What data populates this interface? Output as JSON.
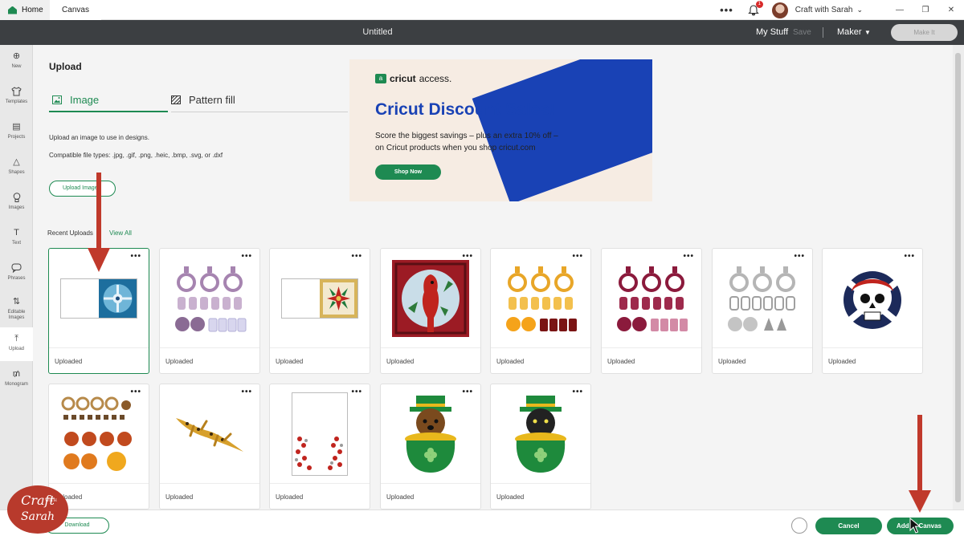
{
  "topbar": {
    "home_label": "Home",
    "canvas_tab": "Canvas",
    "more_dots": "•••",
    "notification_count": "1",
    "user_name": "Craft with Sarah",
    "minimize": "—",
    "restore": "❐",
    "close": "✕"
  },
  "header": {
    "title": "Untitled",
    "my_stuff": "My Stuff",
    "save": "Save",
    "machine": "Maker",
    "make_it": "Make It"
  },
  "rail": [
    {
      "label": "New",
      "icon": "plus-icon",
      "glyph": "⊕"
    },
    {
      "label": "Templates",
      "icon": "shirt-icon",
      "glyph": "👕"
    },
    {
      "label": "Projects",
      "icon": "projects-icon",
      "glyph": "▤"
    },
    {
      "label": "Shapes",
      "icon": "shapes-icon",
      "glyph": "△"
    },
    {
      "label": "Images",
      "icon": "lightbulb-icon",
      "glyph": "♀"
    },
    {
      "label": "Text",
      "icon": "text-icon",
      "glyph": "T"
    },
    {
      "label": "Phrases",
      "icon": "speech-bubble-icon",
      "glyph": "💬"
    },
    {
      "label": "Editable Images",
      "icon": "editable-images-icon",
      "glyph": "⇅"
    },
    {
      "label": "Upload",
      "icon": "upload-icon",
      "glyph": "⤒"
    },
    {
      "label": "Monogram",
      "icon": "monogram-icon",
      "glyph": "₥"
    }
  ],
  "upload": {
    "title": "Upload",
    "tab_image": "Image",
    "tab_pattern": "Pattern fill",
    "description": "Upload an image to use in designs.",
    "types": "Compatible file types: .jpg, .gif, .png, .heic, .bmp, .svg, or .dxf",
    "upload_button": "Upload Image",
    "recent_label": "Recent Uploads",
    "view_all": "View All"
  },
  "ad": {
    "brand": "cricut",
    "brand_suffix": "access.",
    "headline": "Cricut Discount Sales!",
    "line1": "Score the biggest savings – plus an extra 10% off –",
    "line2": "on Cricut products when you shop cricut.com",
    "cta": "Shop Now",
    "accent": "#1942b5"
  },
  "cards": [
    {
      "caption": "Uploaded",
      "thumb": "blue-snowflake-tile"
    },
    {
      "caption": "Uploaded",
      "thumb": "purple-ornaments"
    },
    {
      "caption": "Uploaded",
      "thumb": "poinsettia-tile"
    },
    {
      "caption": "Uploaded",
      "thumb": "cardinal-stained-glass"
    },
    {
      "caption": "Uploaded",
      "thumb": "orange-ornaments"
    },
    {
      "caption": "Uploaded",
      "thumb": "maroon-ornaments"
    },
    {
      "caption": "Uploaded",
      "thumb": "grey-ornaments"
    },
    {
      "caption": "Uploaded",
      "thumb": "pirate-skull"
    },
    {
      "caption": "Uploaded",
      "thumb": "autumn-pieces"
    },
    {
      "caption": "Uploaded",
      "thumb": "gecko"
    },
    {
      "caption": "Uploaded",
      "thumb": "red-flower-border"
    },
    {
      "caption": "Uploaded",
      "thumb": "leprechaun-dog-pot"
    },
    {
      "caption": "Uploaded",
      "thumb": "leprechaun-cat-pot"
    }
  ],
  "card_more": "•••",
  "footer": {
    "download": "Download",
    "cancel": "Cancel",
    "add_to_canvas": "Add to Canvas"
  },
  "watermark": {
    "line1": "Craft",
    "with": "WITH",
    "line2": "Sarah"
  },
  "colors": {
    "brand_green": "#1e8a52",
    "header_dark": "#3c3f42",
    "arrow_red": "#c0392b"
  }
}
